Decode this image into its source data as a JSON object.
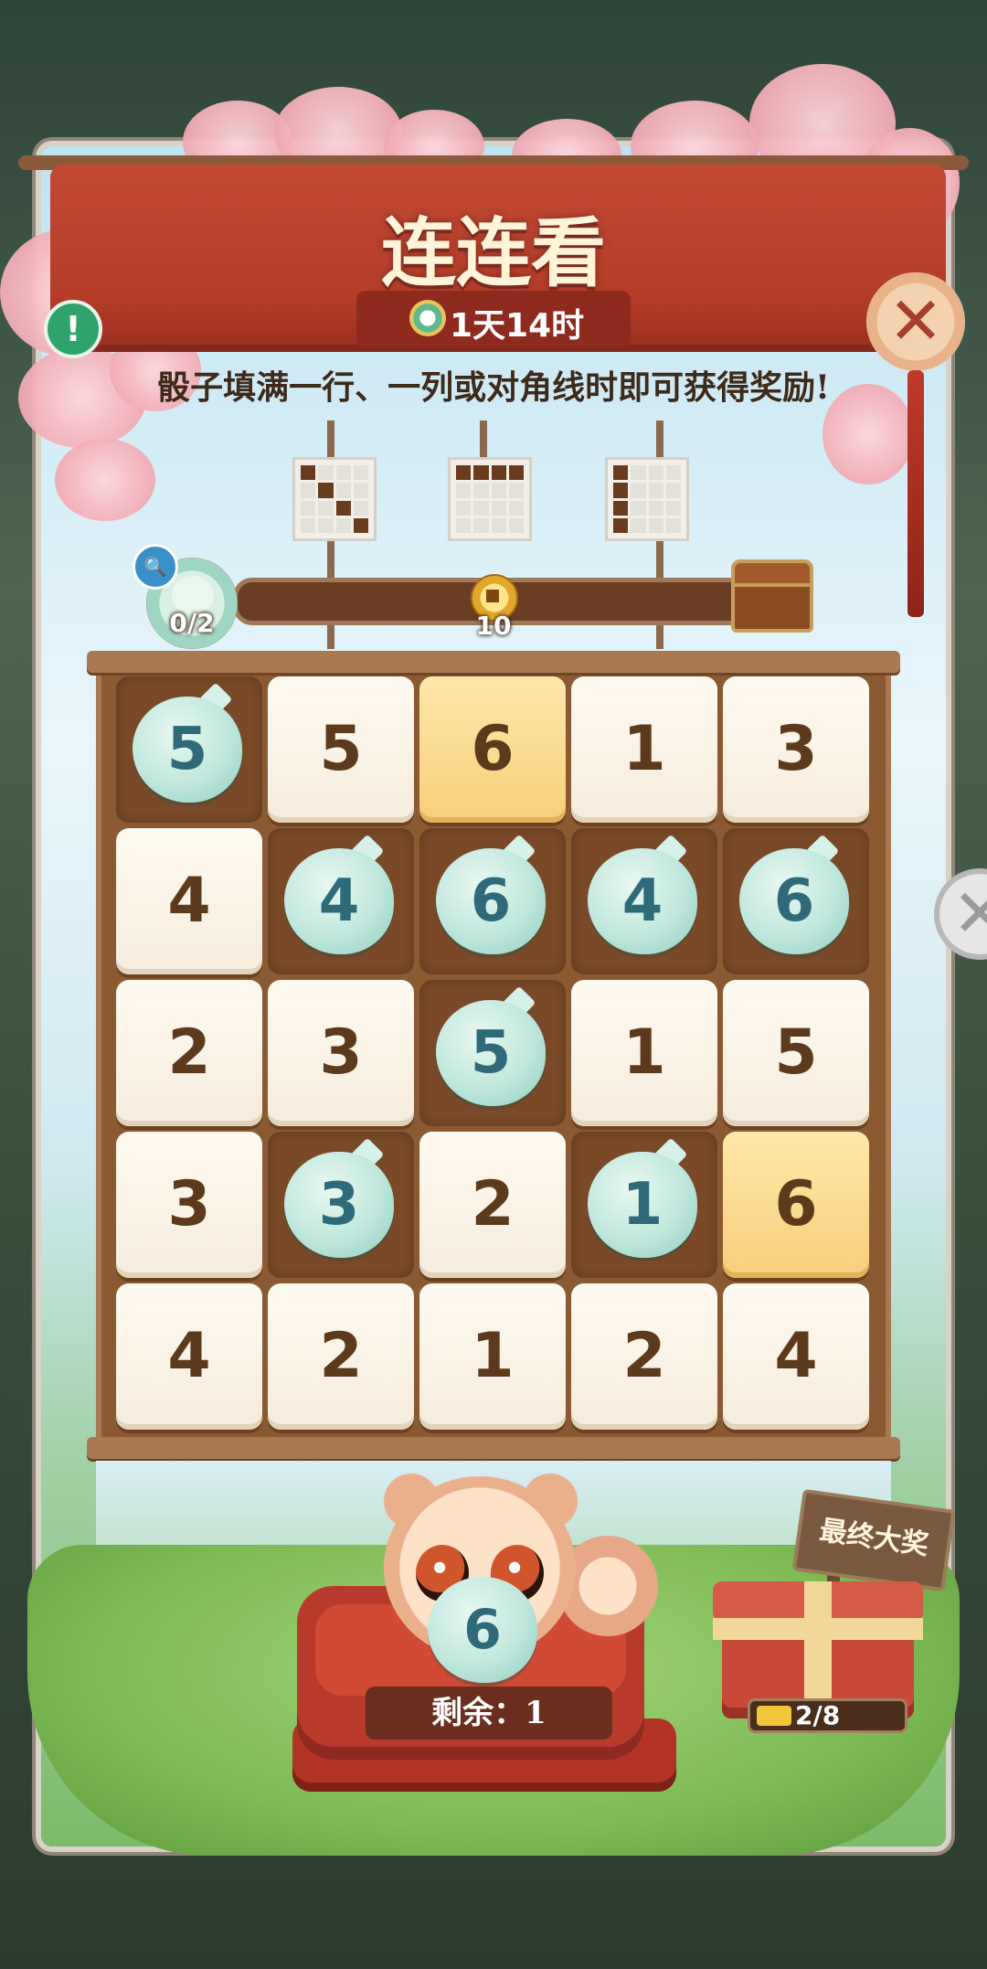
{
  "header": {
    "title": "连连看",
    "timer": "1天14时",
    "instruction": "骰子填满一行、一列或对角线时即可获得奖励!"
  },
  "patterns": [
    {
      "name": "diagonal",
      "cells": [
        1,
        0,
        0,
        0,
        0,
        1,
        0,
        0,
        0,
        0,
        1,
        0,
        0,
        0,
        0,
        1
      ]
    },
    {
      "name": "row",
      "cells": [
        1,
        1,
        1,
        1,
        0,
        0,
        0,
        0,
        0,
        0,
        0,
        0,
        0,
        0,
        0,
        0
      ]
    },
    {
      "name": "column",
      "cells": [
        1,
        0,
        0,
        0,
        1,
        0,
        0,
        0,
        1,
        0,
        0,
        0,
        1,
        0,
        0,
        0
      ]
    }
  ],
  "progress": {
    "label": "0/2",
    "fraction": 0.0,
    "coin_reward": "10"
  },
  "board": {
    "rows": [
      [
        {
          "v": "5",
          "t": "dice"
        },
        {
          "v": "5",
          "t": "plain"
        },
        {
          "v": "6",
          "t": "gold"
        },
        {
          "v": "1",
          "t": "plain"
        },
        {
          "v": "3",
          "t": "plain"
        }
      ],
      [
        {
          "v": "4",
          "t": "plain"
        },
        {
          "v": "4",
          "t": "dice"
        },
        {
          "v": "6",
          "t": "dice"
        },
        {
          "v": "4",
          "t": "dice"
        },
        {
          "v": "6",
          "t": "dice"
        }
      ],
      [
        {
          "v": "2",
          "t": "plain"
        },
        {
          "v": "3",
          "t": "plain"
        },
        {
          "v": "5",
          "t": "dice"
        },
        {
          "v": "1",
          "t": "plain"
        },
        {
          "v": "5",
          "t": "plain"
        }
      ],
      [
        {
          "v": "3",
          "t": "plain"
        },
        {
          "v": "3",
          "t": "dice"
        },
        {
          "v": "2",
          "t": "plain"
        },
        {
          "v": "1",
          "t": "dice"
        },
        {
          "v": "6",
          "t": "gold"
        }
      ],
      [
        {
          "v": "4",
          "t": "plain"
        },
        {
          "v": "2",
          "t": "plain"
        },
        {
          "v": "1",
          "t": "plain"
        },
        {
          "v": "2",
          "t": "plain"
        },
        {
          "v": "4",
          "t": "plain"
        }
      ]
    ]
  },
  "held_dice": {
    "value": "6"
  },
  "remaining": {
    "label": "剩余：1"
  },
  "grand_prize": {
    "sign": "最终大奖",
    "progress_text": "2/8",
    "fraction": 0.25
  },
  "icons": {
    "info": "!",
    "close": "✕",
    "search": "🔍"
  },
  "colors": {
    "banner": "#b43d2a",
    "dice": "#bfe7dc",
    "gold_cell": "#f6cf7a",
    "plain_cell": "#fffaf0"
  }
}
